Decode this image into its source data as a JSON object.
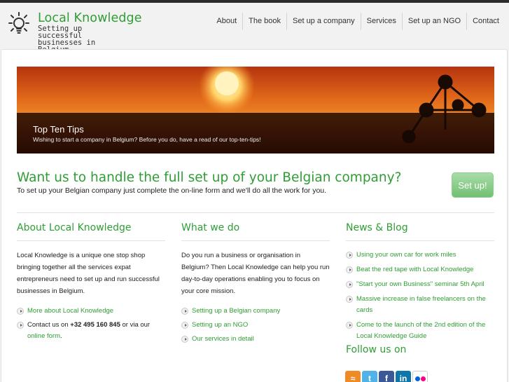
{
  "brand": {
    "title": "Local Knowledge",
    "tagline": "Setting up successful businesses in Belgium"
  },
  "nav": {
    "items": [
      "About",
      "The book",
      "Set up a company",
      "Services",
      "Set up an NGO",
      "Contact"
    ]
  },
  "hero": {
    "title": "Top Ten Tips",
    "subtitle": "Wishing to start a company in Belgium? Before you do, have a read of our top-ten-tips!"
  },
  "cta": {
    "heading": "Want us to handle the full set up of your Belgian company?",
    "text": "To set up your Belgian company just complete the on-line form and we'll do all the work for you.",
    "button": "Set up!"
  },
  "about": {
    "heading": "About Local Knowledge",
    "text": "Local Knowledge is a unique one stop shop bringing together all the services expat entrepreneurs need to set up and run successful businesses in Belgium.",
    "more_link": "More about Local Knowledge",
    "contact_prefix": "Contact us on ",
    "phone": "+32 495 160 845",
    "contact_mid": " or via our ",
    "form_link": "online form",
    "contact_suffix": "."
  },
  "whatwedo": {
    "heading": "What we do",
    "text": "Do you run a business or organisation in Belgium? Then Local Knowledge can help you run day-to-day operations enabling you to focus on your core mission.",
    "links": [
      "Setting up a Belgian company",
      "Setting up an NGO",
      "Our services in detail"
    ]
  },
  "news": {
    "heading": "News & Blog",
    "items": [
      "Using your own car for work miles",
      "Beat the red tape with Local Knowledge",
      "\"Start your own Business\" seminar 5th April",
      "Massive increase in false freelancers on the cards",
      "Come to the launch of the 2nd edition of the Local Knowledge Guide"
    ],
    "follow_heading": "Follow us on"
  },
  "social": {
    "icons": [
      "rss-icon",
      "twitter-icon",
      "facebook-icon",
      "linkedin-icon",
      "flickr-icon"
    ],
    "colors": [
      "#f08a24",
      "#4fb3e8",
      "#3b5998",
      "#0e76a8",
      "#ff0084"
    ]
  }
}
